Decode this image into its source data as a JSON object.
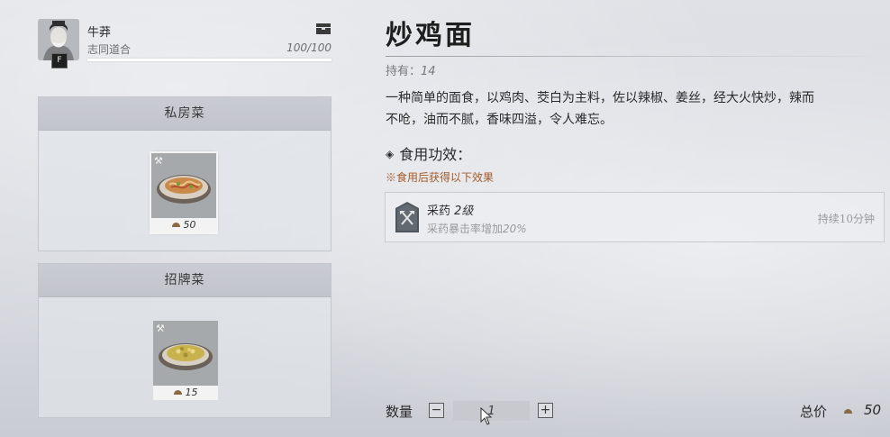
{
  "player": {
    "name": "牛莽",
    "title": "志同道合",
    "favor": "100/100",
    "badge": "F"
  },
  "menus": [
    {
      "header": "私房菜",
      "dish": {
        "price": "50",
        "selected": true,
        "icon": "pickaxe-icon"
      }
    },
    {
      "header": "招牌菜",
      "dish": {
        "price": "15",
        "selected": false,
        "icon": "pickaxe-icon"
      }
    }
  ],
  "detail": {
    "name": "炒鸡面",
    "owned_label": "持有：",
    "owned_value": "14",
    "description_line1": "一种简单的面食，以鸡肉、茭白为主料，佐以辣椒、姜丝，经大火快炒，辣而",
    "description_line2": "不呛，油而不腻，香味四溢，令人难忘。",
    "effects_header": "食用功效：",
    "effects_note": "※食用后获得以下效果",
    "effect": {
      "name": "采药",
      "level": "2级",
      "description": "采药暴击率增加",
      "value": "20%",
      "duration": "持续10分钟",
      "icon": "herb-gathering-icon"
    }
  },
  "purchase": {
    "quantity_label": "数量",
    "quantity_value": "1",
    "minus": "−",
    "plus": "+",
    "total_label": "总价",
    "total_value": "50"
  },
  "colors": {
    "note": "#a35b2c",
    "coin": "#8a6a45"
  }
}
